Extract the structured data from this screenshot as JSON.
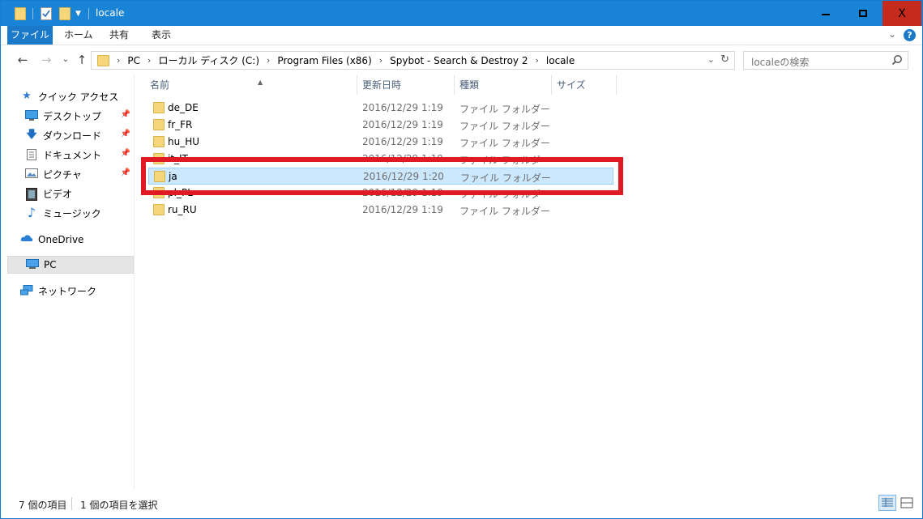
{
  "window": {
    "title": "locale",
    "buttons": {
      "minimize": "minimize",
      "maximize": "maximize",
      "close": "X"
    }
  },
  "ribbon": {
    "tabs": [
      "ファイル",
      "ホーム",
      "共有",
      "表示"
    ],
    "help": "?"
  },
  "address": {
    "crumbs": [
      "PC",
      "ローカル ディスク (C:)",
      "Program Files (x86)",
      "Spybot - Search & Destroy 2",
      "locale"
    ]
  },
  "search": {
    "placeholder": "localeの検索"
  },
  "sidebar": {
    "items": [
      {
        "label": "クイック アクセス",
        "icon": "star-icon"
      },
      {
        "label": "デスクトップ",
        "icon": "desktop-icon",
        "pinned": true
      },
      {
        "label": "ダウンロード",
        "icon": "download-icon",
        "pinned": true
      },
      {
        "label": "ドキュメント",
        "icon": "document-icon",
        "pinned": true
      },
      {
        "label": "ピクチャ",
        "icon": "picture-icon",
        "pinned": true
      },
      {
        "label": "ビデオ",
        "icon": "video-icon"
      },
      {
        "label": "ミュージック",
        "icon": "music-icon"
      },
      {
        "label": "OneDrive",
        "icon": "cloud-icon"
      },
      {
        "label": "PC",
        "icon": "computer-icon",
        "selected": true
      },
      {
        "label": "ネットワーク",
        "icon": "network-icon"
      }
    ]
  },
  "columns": [
    "名前",
    "更新日時",
    "種類",
    "サイズ"
  ],
  "files": [
    {
      "name": "de_DE",
      "date": "2016/12/29 1:19",
      "type": "ファイル フォルダー"
    },
    {
      "name": "fr_FR",
      "date": "2016/12/29 1:19",
      "type": "ファイル フォルダー"
    },
    {
      "name": "hu_HU",
      "date": "2016/12/29 1:19",
      "type": "ファイル フォルダー"
    },
    {
      "name": "it_IT",
      "date": "2016/12/29 1:19",
      "type": "ファイル フォルダー"
    },
    {
      "name": "ja",
      "date": "2016/12/29 1:20",
      "type": "ファイル フォルダー",
      "selected": true
    },
    {
      "name": "pl_PL",
      "date": "2016/12/29 1:19",
      "type": "ファイル フォルダー"
    },
    {
      "name": "ru_RU",
      "date": "2016/12/29 1:19",
      "type": "ファイル フォルダー"
    }
  ],
  "status": {
    "item_count": "7 個の項目",
    "selected_count": "1 個の項目を選択"
  },
  "colors": {
    "accent": "#1983d6",
    "highlight_box": "#e01a22",
    "selection": "#cce8ff"
  }
}
